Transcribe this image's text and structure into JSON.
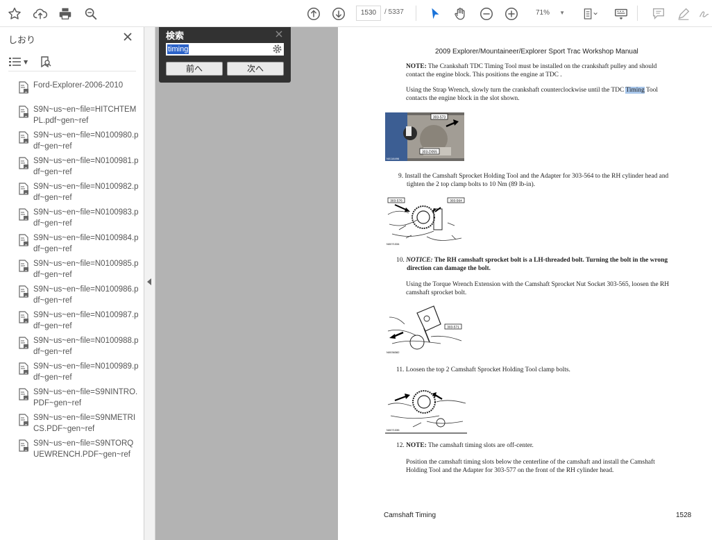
{
  "toolbar": {
    "icons": [
      "star-icon",
      "upload-icon",
      "print-icon",
      "zoom-search-icon",
      "page-up-icon",
      "page-down-icon",
      "select-cursor-icon",
      "hand-icon",
      "zoom-out-icon",
      "zoom-in-icon",
      "fit-page-icon",
      "keyboard-icon",
      "comment-icon",
      "pen-icon",
      "sign-icon"
    ],
    "page_current": "1530",
    "page_total": "/ 5337",
    "zoom": "71%"
  },
  "sidebar": {
    "title": "しおり",
    "bookmarks": [
      "Ford-Explorer-2006-2010",
      "S9N~us~en~file=HITCHTEMPL.pdf~gen~ref",
      "S9N~us~en~file=N0100980.pdf~gen~ref",
      "S9N~us~en~file=N0100981.pdf~gen~ref",
      "S9N~us~en~file=N0100982.pdf~gen~ref",
      "S9N~us~en~file=N0100983.pdf~gen~ref",
      "S9N~us~en~file=N0100984.pdf~gen~ref",
      "S9N~us~en~file=N0100985.pdf~gen~ref",
      "S9N~us~en~file=N0100986.pdf~gen~ref",
      "S9N~us~en~file=N0100987.pdf~gen~ref",
      "S9N~us~en~file=N0100988.pdf~gen~ref",
      "S9N~us~en~file=N0100989.pdf~gen~ref",
      "S9N~us~en~file=S9NINTRO.PDF~gen~ref",
      "S9N~us~en~file=S9NMETRICS.PDF~gen~ref",
      "S9N~us~en~file=S9NTORQUEWRENCH.PDF~gen~ref"
    ]
  },
  "search": {
    "title": "検索",
    "query": "timing",
    "prev_label": "前へ",
    "next_label": "次へ"
  },
  "page": {
    "header": "2009 Explorer/Mountaineer/Explorer Sport Trac Workshop Manual",
    "note1_label": "NOTE:",
    "note1_text": " The Crankshaft TDC Timing Tool must be installed on the crankshaft pulley and should",
    "note1_text2": "contact the engine block. This positions the engine at TDC .",
    "strap_a": "Using the Strap Wrench, slowly turn the crankshaft counterclockwise until the TDC ",
    "strap_hl": "Timing",
    "strap_b": " Tool",
    "strap_2": "contacts the engine block in the slot shown.",
    "step9_a": "9. Install the Camshaft Sprocket Holding Tool and the Adapter for 303-564 to the RH cylinder head and",
    "step9_b": "tighten the 2 top clamp bolts to 10 Nm (89 lb-in).",
    "step10_num": "10. ",
    "step10_notice": "NOTICE:",
    "step10_a": " The RH camshaft sprocket bolt is a LH-threaded bolt. Turning the bolt in the wrong",
    "step10_b": "direction can damage the bolt.",
    "step10_c": "Using the Torque Wrench Extension with the Camshaft Sprocket Nut Socket 303-565, loosen the RH",
    "step10_d": "camshaft sprocket bolt.",
    "step11": "11. Loosen the top 2 Camshaft Sprocket Holding Tool clamp bolts.",
    "step12_num": "12. ",
    "step12_label": "NOTE:",
    "step12_text": " The camshaft timing slots are off-center.",
    "step12_a": "Position the camshaft timing slots below the centerline of the camshaft and install the Camshaft",
    "step12_b": "Holding Tool and the Adapter for 303-577 on the front of the RH cylinder head.",
    "fig1_tag_a": "303-573",
    "fig1_tag_b": "303-D055",
    "fig1_code": "N0116496",
    "fig2_tag_a": "303-576",
    "fig2_tag_b": "303-564",
    "fig2_code": "N0071334",
    "fig3_tag": "303-571",
    "fig3_code": "N0036382",
    "fig4_code": "N0071335",
    "footer_left": "Camshaft Timing",
    "footer_right": "1528"
  }
}
